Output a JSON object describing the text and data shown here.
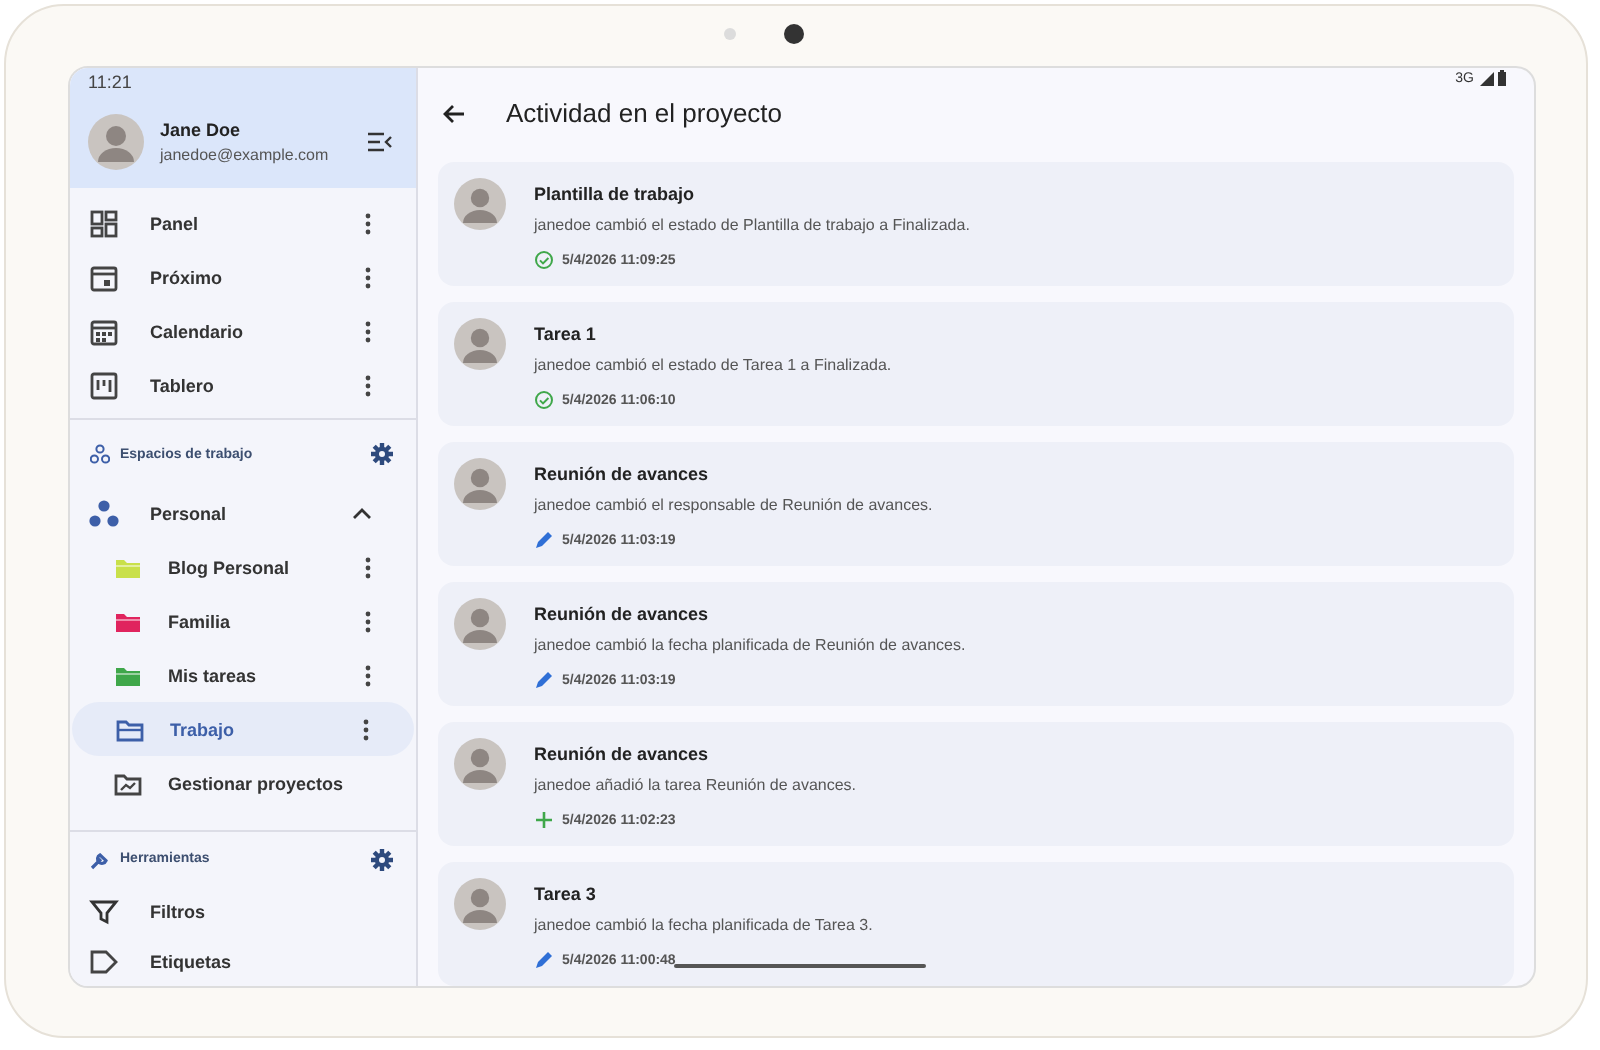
{
  "status_bar": {
    "time": "11:21",
    "network": "3G"
  },
  "user": {
    "name": "Jane Doe",
    "email": "janedoe@example.com"
  },
  "nav_items": [
    {
      "label": "Panel",
      "kind": "dashboard"
    },
    {
      "label": "Próximo",
      "kind": "upcoming"
    },
    {
      "label": "Calendario",
      "kind": "calendar"
    },
    {
      "label": "Tablero",
      "kind": "board"
    }
  ],
  "workspaces": {
    "title": "Espacios de trabajo",
    "group": {
      "label": "Personal",
      "expanded": true,
      "children": [
        {
          "label": "Blog Personal",
          "kind": "folder",
          "color": "#c9e04a",
          "selected": false
        },
        {
          "label": "Familia",
          "kind": "folder",
          "color": "#e0245e",
          "selected": false
        },
        {
          "label": "Mis tareas",
          "kind": "folder",
          "color": "#3fa74a",
          "selected": false
        },
        {
          "label": "Trabajo",
          "kind": "open-folder",
          "selected": true
        },
        {
          "label": "Gestionar proyectos",
          "kind": "manage",
          "selected": false
        }
      ]
    }
  },
  "tools": {
    "title": "Herramientas",
    "items": [
      {
        "label": "Filtros",
        "kind": "filter"
      },
      {
        "label": "Etiquetas",
        "kind": "label"
      }
    ]
  },
  "page_title": "Actividad en el proyecto",
  "activities": [
    {
      "title": "Plantilla de trabajo",
      "text": "janedoe cambió el estado de Plantilla de trabajo a Finalizada.",
      "time": "5/4/2026 11:09:25",
      "kind": "status"
    },
    {
      "title": "Tarea 1",
      "text": "janedoe cambió el estado de Tarea 1 a Finalizada.",
      "time": "5/4/2026 11:06:10",
      "kind": "status"
    },
    {
      "title": "Reunión de avances",
      "text": "janedoe cambió el responsable de Reunión de avances.",
      "time": "5/4/2026 11:03:19",
      "kind": "edit"
    },
    {
      "title": "Reunión de avances",
      "text": "janedoe cambió la fecha planificada de Reunión de avances.",
      "time": "5/4/2026 11:03:19",
      "kind": "edit"
    },
    {
      "title": "Reunión de avances",
      "text": "janedoe añadió la tarea Reunión de avances.",
      "time": "5/4/2026 11:02:23",
      "kind": "add"
    },
    {
      "title": "Tarea 3",
      "text": "janedoe cambió la fecha planificada de Tarea 3.",
      "time": "5/4/2026 11:00:48",
      "kind": "edit"
    }
  ]
}
